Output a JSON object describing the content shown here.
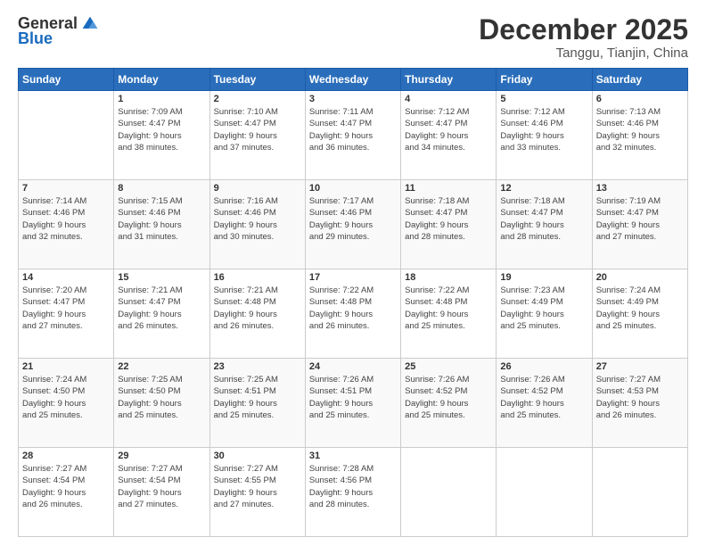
{
  "header": {
    "logo_general": "General",
    "logo_blue": "Blue",
    "month_title": "December 2025",
    "location": "Tanggu, Tianjin, China"
  },
  "weekdays": [
    "Sunday",
    "Monday",
    "Tuesday",
    "Wednesday",
    "Thursday",
    "Friday",
    "Saturday"
  ],
  "weeks": [
    [
      {
        "day": "",
        "sunrise": "",
        "sunset": "",
        "daylight": ""
      },
      {
        "day": "1",
        "sunrise": "Sunrise: 7:09 AM",
        "sunset": "Sunset: 4:47 PM",
        "daylight": "Daylight: 9 hours and 38 minutes."
      },
      {
        "day": "2",
        "sunrise": "Sunrise: 7:10 AM",
        "sunset": "Sunset: 4:47 PM",
        "daylight": "Daylight: 9 hours and 37 minutes."
      },
      {
        "day": "3",
        "sunrise": "Sunrise: 7:11 AM",
        "sunset": "Sunset: 4:47 PM",
        "daylight": "Daylight: 9 hours and 36 minutes."
      },
      {
        "day": "4",
        "sunrise": "Sunrise: 7:12 AM",
        "sunset": "Sunset: 4:47 PM",
        "daylight": "Daylight: 9 hours and 34 minutes."
      },
      {
        "day": "5",
        "sunrise": "Sunrise: 7:12 AM",
        "sunset": "Sunset: 4:46 PM",
        "daylight": "Daylight: 9 hours and 33 minutes."
      },
      {
        "day": "6",
        "sunrise": "Sunrise: 7:13 AM",
        "sunset": "Sunset: 4:46 PM",
        "daylight": "Daylight: 9 hours and 32 minutes."
      }
    ],
    [
      {
        "day": "7",
        "sunrise": "Sunrise: 7:14 AM",
        "sunset": "Sunset: 4:46 PM",
        "daylight": "Daylight: 9 hours and 32 minutes."
      },
      {
        "day": "8",
        "sunrise": "Sunrise: 7:15 AM",
        "sunset": "Sunset: 4:46 PM",
        "daylight": "Daylight: 9 hours and 31 minutes."
      },
      {
        "day": "9",
        "sunrise": "Sunrise: 7:16 AM",
        "sunset": "Sunset: 4:46 PM",
        "daylight": "Daylight: 9 hours and 30 minutes."
      },
      {
        "day": "10",
        "sunrise": "Sunrise: 7:17 AM",
        "sunset": "Sunset: 4:46 PM",
        "daylight": "Daylight: 9 hours and 29 minutes."
      },
      {
        "day": "11",
        "sunrise": "Sunrise: 7:18 AM",
        "sunset": "Sunset: 4:47 PM",
        "daylight": "Daylight: 9 hours and 28 minutes."
      },
      {
        "day": "12",
        "sunrise": "Sunrise: 7:18 AM",
        "sunset": "Sunset: 4:47 PM",
        "daylight": "Daylight: 9 hours and 28 minutes."
      },
      {
        "day": "13",
        "sunrise": "Sunrise: 7:19 AM",
        "sunset": "Sunset: 4:47 PM",
        "daylight": "Daylight: 9 hours and 27 minutes."
      }
    ],
    [
      {
        "day": "14",
        "sunrise": "Sunrise: 7:20 AM",
        "sunset": "Sunset: 4:47 PM",
        "daylight": "Daylight: 9 hours and 27 minutes."
      },
      {
        "day": "15",
        "sunrise": "Sunrise: 7:21 AM",
        "sunset": "Sunset: 4:47 PM",
        "daylight": "Daylight: 9 hours and 26 minutes."
      },
      {
        "day": "16",
        "sunrise": "Sunrise: 7:21 AM",
        "sunset": "Sunset: 4:48 PM",
        "daylight": "Daylight: 9 hours and 26 minutes."
      },
      {
        "day": "17",
        "sunrise": "Sunrise: 7:22 AM",
        "sunset": "Sunset: 4:48 PM",
        "daylight": "Daylight: 9 hours and 26 minutes."
      },
      {
        "day": "18",
        "sunrise": "Sunrise: 7:22 AM",
        "sunset": "Sunset: 4:48 PM",
        "daylight": "Daylight: 9 hours and 25 minutes."
      },
      {
        "day": "19",
        "sunrise": "Sunrise: 7:23 AM",
        "sunset": "Sunset: 4:49 PM",
        "daylight": "Daylight: 9 hours and 25 minutes."
      },
      {
        "day": "20",
        "sunrise": "Sunrise: 7:24 AM",
        "sunset": "Sunset: 4:49 PM",
        "daylight": "Daylight: 9 hours and 25 minutes."
      }
    ],
    [
      {
        "day": "21",
        "sunrise": "Sunrise: 7:24 AM",
        "sunset": "Sunset: 4:50 PM",
        "daylight": "Daylight: 9 hours and 25 minutes."
      },
      {
        "day": "22",
        "sunrise": "Sunrise: 7:25 AM",
        "sunset": "Sunset: 4:50 PM",
        "daylight": "Daylight: 9 hours and 25 minutes."
      },
      {
        "day": "23",
        "sunrise": "Sunrise: 7:25 AM",
        "sunset": "Sunset: 4:51 PM",
        "daylight": "Daylight: 9 hours and 25 minutes."
      },
      {
        "day": "24",
        "sunrise": "Sunrise: 7:26 AM",
        "sunset": "Sunset: 4:51 PM",
        "daylight": "Daylight: 9 hours and 25 minutes."
      },
      {
        "day": "25",
        "sunrise": "Sunrise: 7:26 AM",
        "sunset": "Sunset: 4:52 PM",
        "daylight": "Daylight: 9 hours and 25 minutes."
      },
      {
        "day": "26",
        "sunrise": "Sunrise: 7:26 AM",
        "sunset": "Sunset: 4:52 PM",
        "daylight": "Daylight: 9 hours and 25 minutes."
      },
      {
        "day": "27",
        "sunrise": "Sunrise: 7:27 AM",
        "sunset": "Sunset: 4:53 PM",
        "daylight": "Daylight: 9 hours and 26 minutes."
      }
    ],
    [
      {
        "day": "28",
        "sunrise": "Sunrise: 7:27 AM",
        "sunset": "Sunset: 4:54 PM",
        "daylight": "Daylight: 9 hours and 26 minutes."
      },
      {
        "day": "29",
        "sunrise": "Sunrise: 7:27 AM",
        "sunset": "Sunset: 4:54 PM",
        "daylight": "Daylight: 9 hours and 27 minutes."
      },
      {
        "day": "30",
        "sunrise": "Sunrise: 7:27 AM",
        "sunset": "Sunset: 4:55 PM",
        "daylight": "Daylight: 9 hours and 27 minutes."
      },
      {
        "day": "31",
        "sunrise": "Sunrise: 7:28 AM",
        "sunset": "Sunset: 4:56 PM",
        "daylight": "Daylight: 9 hours and 28 minutes."
      },
      {
        "day": "",
        "sunrise": "",
        "sunset": "",
        "daylight": ""
      },
      {
        "day": "",
        "sunrise": "",
        "sunset": "",
        "daylight": ""
      },
      {
        "day": "",
        "sunrise": "",
        "sunset": "",
        "daylight": ""
      }
    ]
  ]
}
